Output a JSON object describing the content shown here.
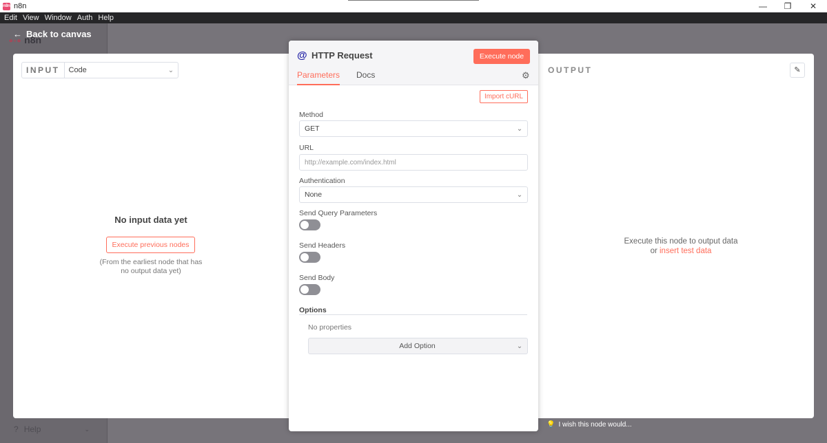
{
  "window": {
    "title": "n8n",
    "minimize": "—",
    "restore": "❐",
    "close": "✕"
  },
  "menu": [
    "Edit",
    "View",
    "Window",
    "Auth",
    "Help"
  ],
  "app": {
    "logo_text": "n8n",
    "back_label": "Back to canvas",
    "help_label": "Help"
  },
  "input": {
    "label": "INPUT",
    "mode": "Code",
    "empty_title": "No input data yet",
    "execute_previous": "Execute previous nodes",
    "hint_line1": "(From the earliest node that has",
    "hint_line2": "no output data yet)"
  },
  "node": {
    "icon": "@",
    "title": "HTTP Request",
    "execute_label": "Execute node",
    "tabs": [
      "Parameters",
      "Docs"
    ],
    "import_curl": "Import cURL",
    "method": {
      "label": "Method",
      "value": "GET"
    },
    "url": {
      "label": "URL",
      "placeholder": "http://example.com/index.html"
    },
    "authentication": {
      "label": "Authentication",
      "value": "None"
    },
    "send_query": {
      "label": "Send Query Parameters",
      "enabled": false
    },
    "send_headers": {
      "label": "Send Headers",
      "enabled": false
    },
    "send_body": {
      "label": "Send Body",
      "enabled": false
    },
    "options": {
      "label": "Options",
      "empty": "No properties",
      "add_label": "Add Option"
    }
  },
  "output": {
    "label": "OUTPUT",
    "message_line1": "Execute this node to output data",
    "message_or": "or",
    "insert_link": "insert test data"
  },
  "feedback": {
    "label": "I wish this node would..."
  },
  "colors": {
    "accent": "#ff6d5a",
    "node_icon": "#2222a6",
    "overlay": "#77747a"
  }
}
